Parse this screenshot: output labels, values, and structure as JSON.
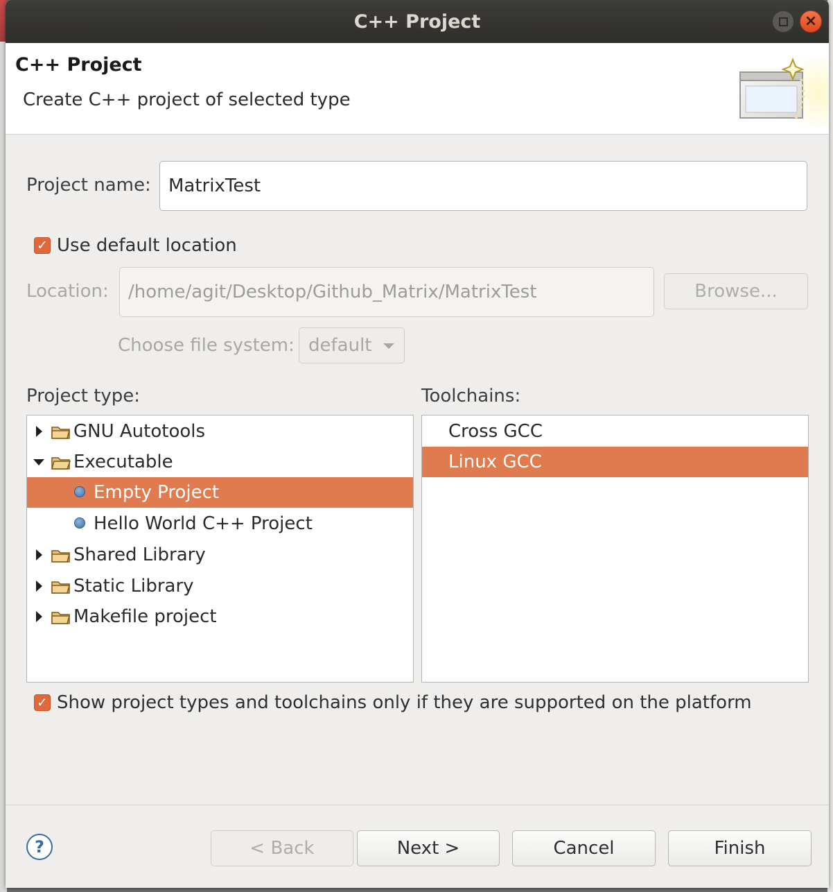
{
  "window": {
    "title": "C++ Project",
    "controls": {
      "maximize_icon": "maximize-icon",
      "close_icon": "close-icon",
      "close_glyph": "×"
    }
  },
  "banner": {
    "title": "C++ Project",
    "description": "Create C++ project of selected type",
    "icon": "new-project-wizard-icon"
  },
  "project_name": {
    "label": "Project name:",
    "value": "MatrixTest"
  },
  "use_default_location": {
    "label": "Use default location",
    "checked": true
  },
  "location": {
    "label": "Location:",
    "value": "/home/agit/Desktop/Github_Matrix/MatrixTest",
    "browse_label": "Browse...",
    "enabled": false
  },
  "file_system": {
    "label": "Choose file system:",
    "selected": "default",
    "enabled": false
  },
  "project_type": {
    "label": "Project type:",
    "items": [
      {
        "label": "GNU Autotools",
        "kind": "folder",
        "expanded": false,
        "level": 0
      },
      {
        "label": "Executable",
        "kind": "folder",
        "expanded": true,
        "level": 0
      },
      {
        "label": "Empty Project",
        "kind": "template",
        "level": 1,
        "selected": true
      },
      {
        "label": "Hello World C++ Project",
        "kind": "template",
        "level": 1
      },
      {
        "label": "Shared Library",
        "kind": "folder",
        "expanded": false,
        "level": 0
      },
      {
        "label": "Static Library",
        "kind": "folder",
        "expanded": false,
        "level": 0
      },
      {
        "label": "Makefile project",
        "kind": "folder",
        "expanded": false,
        "level": 0
      }
    ]
  },
  "toolchains": {
    "label": "Toolchains:",
    "items": [
      {
        "label": "Cross GCC",
        "selected": false
      },
      {
        "label": "Linux GCC",
        "selected": true
      }
    ]
  },
  "show_supported": {
    "label": "Show project types and toolchains only if they are supported on the platform",
    "checked": true
  },
  "footer": {
    "help_glyph": "?",
    "back_label": "< Back",
    "next_label": "Next >",
    "cancel_label": "Cancel",
    "finish_label": "Finish"
  },
  "colors": {
    "selection": "#e07b4f",
    "checkbox": "#e0683b",
    "titlebar": "#2f2e2b"
  }
}
